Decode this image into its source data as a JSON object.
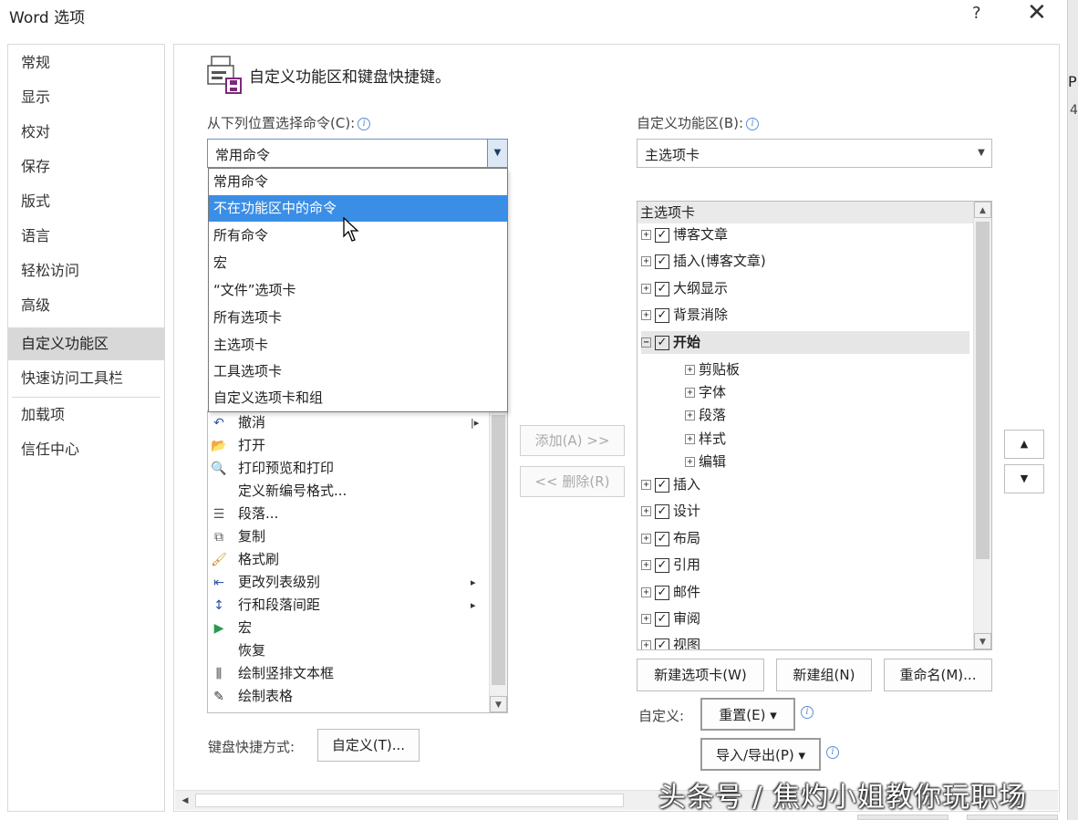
{
  "window": {
    "title": "Word 选项",
    "help": "?",
    "close": "✕"
  },
  "edge": {
    "ch1": "P",
    "ch2": "4"
  },
  "nav": {
    "items": [
      "常规",
      "显示",
      "校对",
      "保存",
      "版式",
      "语言",
      "轻松访问",
      "高级",
      "自定义功能区",
      "快速访问工具栏",
      "加载项",
      "信任中心"
    ],
    "selected_index": 8
  },
  "header": {
    "title": "自定义功能区和键盘快捷键。"
  },
  "left": {
    "choose_label": "从下列位置选择命令(C):",
    "choose_value": "常用命令",
    "dropdown_items": [
      "常用命令",
      "不在功能区中的命令",
      "所有命令",
      "宏",
      "“文件”选项卡",
      "所有选项卡",
      "主选项卡",
      "工具选项卡",
      "自定义选项卡和组"
    ],
    "highlight_index": 1,
    "commands": [
      {
        "icon": "undo-icon",
        "glyph": "↶",
        "label": "撤消",
        "color": "#2a56a8",
        "submenu": "|▸"
      },
      {
        "icon": "folder-icon",
        "glyph": "📂",
        "label": "打开",
        "color": "#e0a030"
      },
      {
        "icon": "print-preview-icon",
        "glyph": "🔍",
        "label": "打印预览和打印",
        "color": "#333333"
      },
      {
        "icon": "",
        "glyph": "",
        "label": "定义新编号格式...",
        "color": "#333333"
      },
      {
        "icon": "paragraph-icon",
        "glyph": "☰",
        "label": "段落...",
        "color": "#555555"
      },
      {
        "icon": "copy-icon",
        "glyph": "⧉",
        "label": "复制",
        "color": "#555555"
      },
      {
        "icon": "format-painter-icon",
        "glyph": "🖌",
        "label": "格式刷",
        "color": "#c88a2a"
      },
      {
        "icon": "list-level-icon",
        "glyph": "⇤",
        "label": "更改列表级别",
        "color": "#2a56a8",
        "submenu": "▸"
      },
      {
        "icon": "line-spacing-icon",
        "glyph": "↕",
        "label": "行和段落间距",
        "color": "#2a56a8",
        "submenu": "▸"
      },
      {
        "icon": "macro-play-icon",
        "glyph": "▶",
        "label": "宏",
        "color": "#2a9a4a"
      },
      {
        "icon": "",
        "glyph": "",
        "label": "恢复",
        "color": "#333333"
      },
      {
        "icon": "vertical-textbox-icon",
        "glyph": "⫼",
        "label": "绘制竖排文本框",
        "color": "#333333"
      },
      {
        "icon": "draw-table-icon",
        "glyph": "✎",
        "label": "绘制表格",
        "color": "#333333"
      }
    ],
    "shortcut_label": "键盘快捷方式:",
    "shortcut_button": "自定义(T)..."
  },
  "middle": {
    "add_button": "添加(A) >>",
    "remove_button": "<< 删除(R)"
  },
  "right": {
    "customize_label": "自定义功能区(B):",
    "customize_value": "主选项卡",
    "tree_header": "主选项卡",
    "tree": [
      {
        "label": "博客文章",
        "level": 0,
        "expander": "⊞",
        "checked": true
      },
      {
        "label": "插入(博客文章)",
        "level": 0,
        "expander": "⊞",
        "checked": true
      },
      {
        "label": "大纲显示",
        "level": 0,
        "expander": "⊞",
        "checked": true
      },
      {
        "label": "背景消除",
        "level": 0,
        "expander": "⊞",
        "checked": true
      },
      {
        "label": "开始",
        "level": 0,
        "expander": "⊟",
        "checked": true,
        "selected": true
      },
      {
        "label": "剪贴板",
        "level": 1,
        "expander": "⊞"
      },
      {
        "label": "字体",
        "level": 1,
        "expander": "⊞"
      },
      {
        "label": "段落",
        "level": 1,
        "expander": "⊞"
      },
      {
        "label": "样式",
        "level": 1,
        "expander": "⊞"
      },
      {
        "label": "编辑",
        "level": 1,
        "expander": "⊞"
      },
      {
        "label": "插入",
        "level": 0,
        "expander": "⊞",
        "checked": true
      },
      {
        "label": "设计",
        "level": 0,
        "expander": "⊞",
        "checked": true
      },
      {
        "label": "布局",
        "level": 0,
        "expander": "⊞",
        "checked": true
      },
      {
        "label": "引用",
        "level": 0,
        "expander": "⊞",
        "checked": true
      },
      {
        "label": "邮件",
        "level": 0,
        "expander": "⊞",
        "checked": true
      },
      {
        "label": "审阅",
        "level": 0,
        "expander": "⊞",
        "checked": true
      },
      {
        "label": "视图",
        "level": 0,
        "expander": "⊞",
        "checked": true
      }
    ],
    "new_tab_button": "新建选项卡(W)",
    "new_group_button": "新建组(N)",
    "rename_button": "重命名(M)...",
    "custom_label": "自定义:",
    "reset_button": "重置(E) ▾",
    "import_export_button": "导入/导出(P) ▾",
    "up": "▲",
    "down": "▼"
  },
  "scroll": {
    "up": "▲",
    "down": "▼",
    "left": "◀"
  },
  "watermark": "头条号 / 焦灼小姐教你玩职场"
}
